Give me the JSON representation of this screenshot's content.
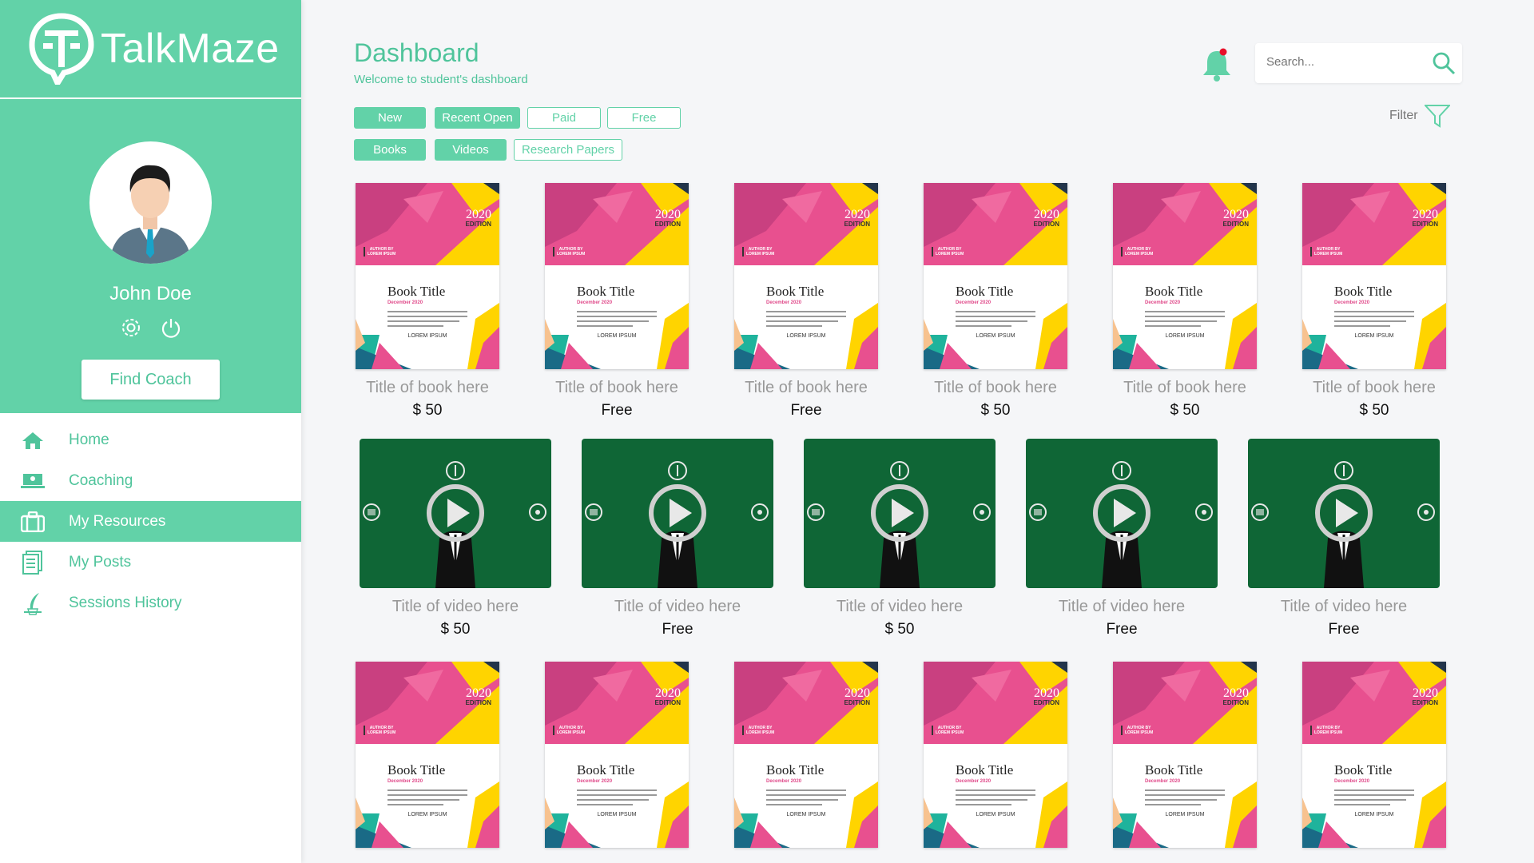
{
  "brand": {
    "name": "TalkMaze"
  },
  "user": {
    "name": "John Doe",
    "find_coach": "Find Coach"
  },
  "nav": [
    {
      "label": "Home",
      "icon": "home-icon",
      "active": false
    },
    {
      "label": "Coaching",
      "icon": "coaching-icon",
      "active": false
    },
    {
      "label": "My Resources",
      "icon": "briefcase-icon",
      "active": true
    },
    {
      "label": "My Posts",
      "icon": "posts-icon",
      "active": false
    },
    {
      "label": "Sessions History",
      "icon": "history-icon",
      "active": false
    }
  ],
  "header": {
    "title": "Dashboard",
    "subtitle": "Welcome to student's dashboard",
    "search_placeholder": "Search...",
    "filter_label": "Filter"
  },
  "chips_row1": [
    {
      "label": "New",
      "on": true
    },
    {
      "label": "Recent Open",
      "on": true
    },
    {
      "label": "Paid",
      "on": false
    },
    {
      "label": "Free",
      "on": false
    }
  ],
  "chips_row2": [
    {
      "label": "Books",
      "on": true
    },
    {
      "label": "Videos",
      "on": true
    },
    {
      "label": "Research Papers",
      "on": false
    }
  ],
  "book_cover": {
    "year": "2020",
    "edition": "EDITION",
    "author_by": "AUTHOR BY",
    "author": "LOREM IPSUM",
    "title": "Book Title",
    "date": "December 2020",
    "footer": "LOREM IPSUM"
  },
  "books_row1": [
    {
      "title": "Title of book here",
      "price": "$ 50"
    },
    {
      "title": "Title of book here",
      "price": "Free"
    },
    {
      "title": "Title of book here",
      "price": "Free"
    },
    {
      "title": "Title of book here",
      "price": "$ 50"
    },
    {
      "title": "Title of book here",
      "price": "$ 50"
    },
    {
      "title": "Title of book here",
      "price": "$ 50"
    }
  ],
  "videos": [
    {
      "title": "Title of video here",
      "price": "$ 50"
    },
    {
      "title": "Title of video here",
      "price": "Free"
    },
    {
      "title": "Title of video here",
      "price": "$ 50"
    },
    {
      "title": "Title of video here",
      "price": "Free"
    },
    {
      "title": "Title of video here",
      "price": "Free"
    }
  ],
  "books_row3": [
    {},
    {},
    {},
    {},
    {},
    {}
  ],
  "colors": {
    "accent": "#62d2a8",
    "accent_text": "#4fc49b",
    "video_bg": "#0f6636",
    "cover_pink": "#e8508f",
    "cover_yellow": "#ffd400",
    "cover_teal": "#1fb39c"
  }
}
